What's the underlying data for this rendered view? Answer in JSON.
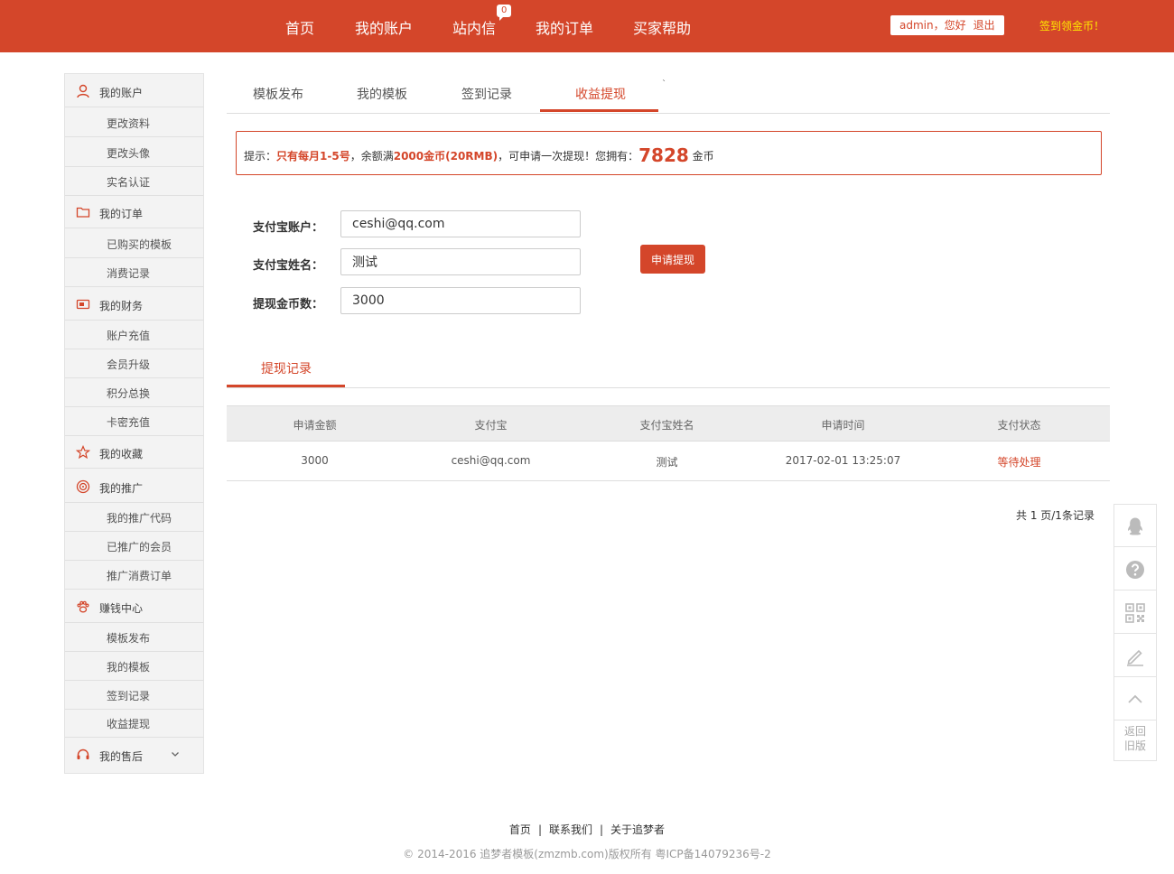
{
  "header": {
    "nav": [
      "首页",
      "我的账户",
      "站内信",
      "我的订单",
      "买家帮助"
    ],
    "message_count": "0",
    "user": {
      "name": "admin",
      "greeting": "，您好",
      "logout": "退出"
    },
    "signin_coin": "签到领金币！"
  },
  "sidebar": {
    "groups": [
      {
        "label": "我的账户",
        "icon": "user-icon",
        "items": [
          "更改资料",
          "更改头像",
          "实名认证"
        ]
      },
      {
        "label": "我的订单",
        "icon": "folder-icon",
        "items": [
          "已购买的模板",
          "消费记录"
        ]
      },
      {
        "label": "我的财务",
        "icon": "wallet-icon",
        "items": [
          "账户充值",
          "会员升级",
          "积分总换",
          "卡密充值"
        ]
      },
      {
        "label": "我的收藏",
        "icon": "star-icon",
        "items": []
      },
      {
        "label": "我的推广",
        "icon": "target-icon",
        "items": [
          "我的推广代码",
          "已推广的会员",
          "推广消费订单"
        ]
      },
      {
        "label": "赚钱中心",
        "icon": "paw-icon",
        "items": [
          "模板发布",
          "我的模板",
          "签到记录",
          "收益提现"
        ]
      },
      {
        "label": "我的售后",
        "icon": "headset-icon",
        "items": []
      }
    ]
  },
  "tabs": [
    "模板发布",
    "我的模板",
    "签到记录",
    "收益提现"
  ],
  "tick": "`",
  "notice": {
    "prefix": "提示：",
    "highlight1": "只有每月1-5号",
    "middle1": "，余额满",
    "highlight2": "2000金币(20RMB)",
    "middle2": "，可申请一次提现！您拥有：",
    "coins": "7828",
    "suffix": " 金币"
  },
  "form": {
    "account_label": "支付宝账户：",
    "account_value": "ceshi@qq.com",
    "name_label": "支付宝姓名：",
    "name_value": "测试",
    "amount_label": "提现金币数：",
    "amount_value": "3000",
    "submit": "申请提现"
  },
  "records": {
    "tab": "提现记录",
    "columns": [
      "申请金额",
      "支付宝",
      "支付宝姓名",
      "申请时间",
      "支付状态"
    ],
    "rows": [
      [
        "3000",
        "ceshi@qq.com",
        "测试",
        "2017-02-01 13:25:07",
        "等待处理"
      ]
    ],
    "pager": "共 1 页/1条记录"
  },
  "float_bar": {
    "icons": [
      "qq-icon",
      "help-icon",
      "qrcode-icon",
      "edit-icon",
      "back-to-top-icon"
    ],
    "back_line1": "返回",
    "back_line2": "旧版"
  },
  "footer": {
    "links": [
      "首页",
      "联系我们",
      "关于追梦者"
    ],
    "sep": "|",
    "copyright": "© 2014-2016 追梦者模板(zmzmb.com)版权所有 粤ICP备14079236号-2"
  },
  "colors": {
    "brand": "#d4462a",
    "highlight": "#ffea00"
  }
}
